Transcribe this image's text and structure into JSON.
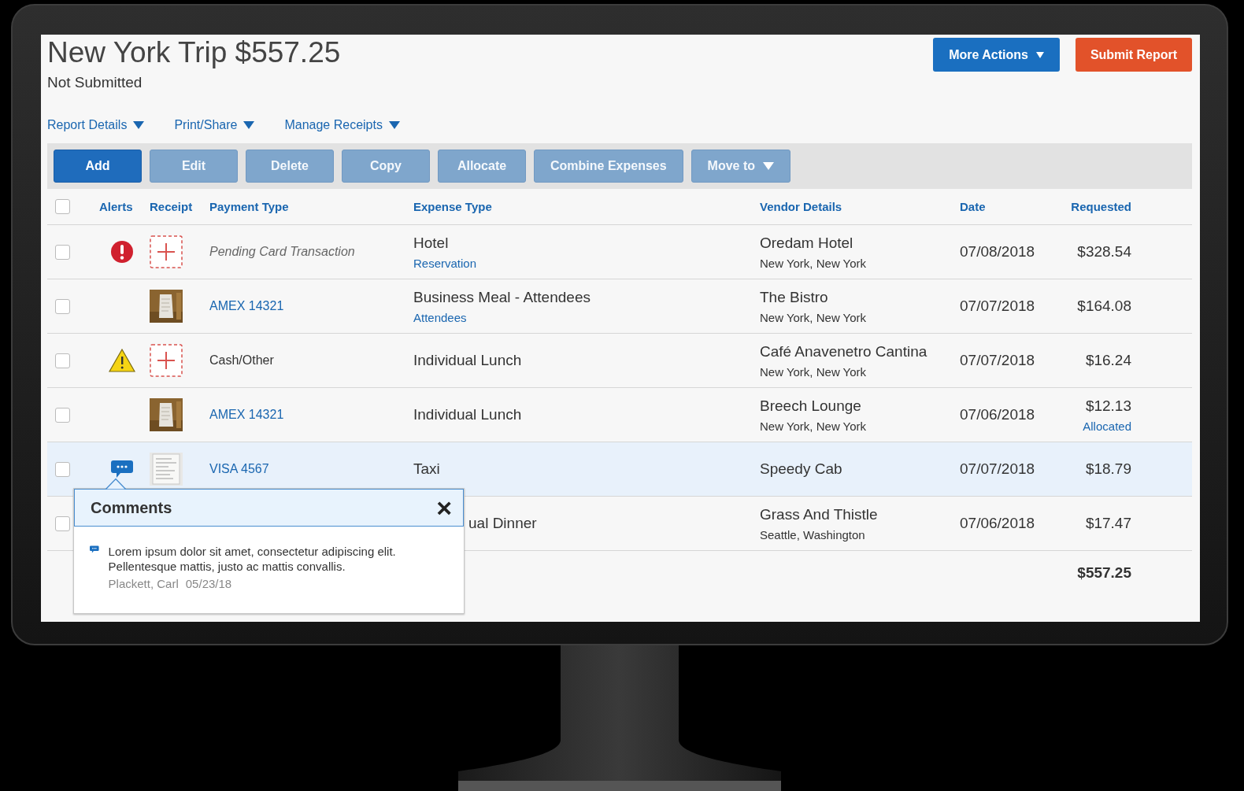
{
  "report": {
    "title": "New York Trip $557.25",
    "status": "Not Submitted"
  },
  "header_buttons": [
    {
      "label": "More Actions",
      "kind": "menu"
    },
    {
      "label": "Submit Report",
      "kind": "primary"
    }
  ],
  "menus": [
    "Report Details",
    "Print/Share",
    "Manage Receipts"
  ],
  "toolbar": [
    {
      "label": "Add",
      "disabled": false,
      "dropdown": false
    },
    {
      "label": "Edit",
      "disabled": true,
      "dropdown": false
    },
    {
      "label": "Delete",
      "disabled": true,
      "dropdown": false
    },
    {
      "label": "Copy",
      "disabled": true,
      "dropdown": false
    },
    {
      "label": "Allocate",
      "disabled": true,
      "dropdown": false
    },
    {
      "label": "Combine Expenses",
      "disabled": true,
      "dropdown": false
    },
    {
      "label": "Move to",
      "disabled": true,
      "dropdown": true
    }
  ],
  "table": {
    "all_checked": false,
    "columns": [
      "Alerts",
      "Receipt",
      "Payment Type",
      "Expense Type",
      "Vendor Details",
      "Date",
      "Requested"
    ],
    "rows": [
      {
        "checked": false,
        "selected": false,
        "alert": {
          "kind": "error"
        },
        "receipt": {
          "kind": "missing"
        },
        "payment": {
          "text": "Pending Card Transaction",
          "kind": "pending"
        },
        "expense": "Hotel",
        "expense_link": "Reservation",
        "vendor": "Oredam Hotel",
        "location": "New York, New York",
        "date": "07/08/2018",
        "amount": "$328.54"
      },
      {
        "checked": false,
        "selected": false,
        "payment": {
          "text": "AMEX 14321",
          "kind": "card"
        },
        "expense": "Business Meal - Attendees",
        "expense_link": "Attendees",
        "vendor": "The Bistro",
        "location": "New York, New York",
        "date": "07/07/2018",
        "amount": "$164.08"
      },
      {
        "checked": false,
        "selected": false,
        "alert": {
          "kind": "warning"
        },
        "receipt": {
          "kind": "missing"
        },
        "payment": {
          "text": "Cash/Other",
          "kind": "cash"
        },
        "expense": "Individual Lunch",
        "vendor": "Café Anavenetro Cantina",
        "location": "New York, New York",
        "date": "07/07/2018",
        "amount": "$16.24"
      },
      {
        "checked": false,
        "selected": false,
        "payment": {
          "text": "AMEX 14321",
          "kind": "card"
        },
        "expense": "Individual Lunch",
        "vendor": "Breech Lounge",
        "location": "New York, New York",
        "date": "07/06/2018",
        "amount": "$12.13",
        "amount_link": "Allocated"
      },
      {
        "checked": false,
        "selected": true,
        "alert": {
          "kind": "comment"
        },
        "receipt": {
          "kind": "scan"
        },
        "payment": {
          "text": "VISA 4567",
          "kind": "card"
        },
        "expense": "Taxi",
        "vendor": "Speedy Cab",
        "date": "07/07/2018",
        "amount": "$18.79"
      },
      {
        "checked": false,
        "selected": false,
        "expense": "ual Dinner",
        "vendor": "Grass And Thistle",
        "location": "Seattle, Washington",
        "date": "07/06/2018",
        "amount": "$17.47"
      }
    ],
    "total": "$557.25"
  },
  "comments_popup": {
    "title": "Comments",
    "close": "×",
    "text": "Lorem ipsum dolor sit amet, consectetur adipiscing elit. Pellentesque mattis, justo ac mattis convallis.",
    "author": "Plackett, Carl",
    "date": "05/23/18"
  }
}
